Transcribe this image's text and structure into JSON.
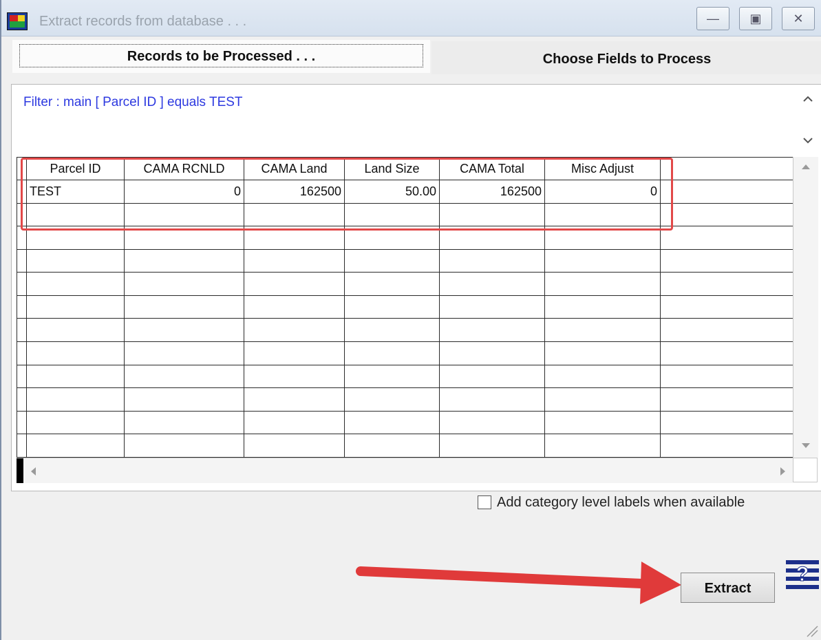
{
  "window": {
    "title": "Extract records from database . . .",
    "minimize_glyph": "—",
    "maximize_glyph": "▣",
    "close_glyph": "✕"
  },
  "tabs": [
    {
      "label": "Records to be Processed . . .",
      "active": true
    },
    {
      "label": "Choose Fields to Process",
      "active": false
    }
  ],
  "filter": {
    "text": "Filter : main [ Parcel ID ] equals TEST"
  },
  "grid": {
    "columns": [
      "Parcel ID",
      "CAMA RCNLD",
      "CAMA Land",
      "Land Size",
      "CAMA Total",
      "Misc Adjust"
    ],
    "rows": [
      [
        "TEST",
        "0",
        "162500",
        "50.00",
        "162500",
        "0"
      ]
    ]
  },
  "options": {
    "category_labels": {
      "label": "Add category level labels when available",
      "checked": false
    }
  },
  "actions": {
    "extract_label": "Extract"
  },
  "colors": {
    "filter_text": "#2d39e0",
    "highlight": "#e24848",
    "arrow": "#e03a3a"
  },
  "icons": [
    "app-icon",
    "help-icon",
    "scroll-up-icon",
    "scroll-down-icon",
    "scroll-left-icon",
    "scroll-right-icon"
  ]
}
